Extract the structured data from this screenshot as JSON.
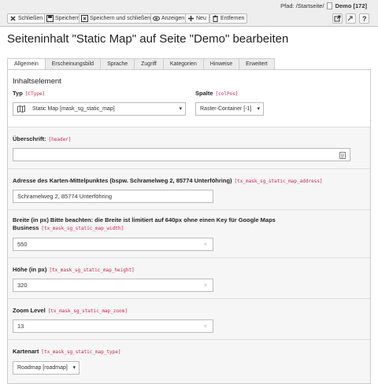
{
  "toolbar": {
    "close": "Schließen",
    "save": "Speichern",
    "save_close": "Speichern und schließen",
    "view": "Anzeigen",
    "new": "Neu",
    "delete": "Entfernen"
  },
  "breadcrumb": {
    "prefix": "Pfad: /Startseite/",
    "page": "Demo [172]"
  },
  "page_title": "Seiteninhalt \"Static Map\" auf Seite \"Demo\" bearbeiten",
  "tabs": [
    "Allgemein",
    "Erscheinungsbild",
    "Sprache",
    "Zugriff",
    "Kategorien",
    "Hinweise",
    "Erweitert"
  ],
  "form": {
    "section_heading": "Inhaltselement",
    "ctype_label": "Typ",
    "ctype_code": "[CType]",
    "ctype_value": "Static Map [mask_sg_static_map]",
    "colpos_label": "Spalte",
    "colpos_code": "[colPos]",
    "colpos_value": "Raster-Container [-1]",
    "header_label": "Überschrift:",
    "header_code": "[header]",
    "header_value": "",
    "address_label": "Adresse des Karten-Mittelpunktes (bspw. Schramelweg 2, 85774 Unterföhring)",
    "address_code": "[tx_mask_sg_static_map_address]",
    "address_value": "Schramelweg 2, 85774 Unterföhring",
    "width_label_1": "Breite (in px) Bitte beachten: die Breite ist limitiert auf 640px ohne einen Key für Google Maps",
    "width_label_2": "Business",
    "width_code": "[tx_mask_sg_static_map_width]",
    "width_value": "550",
    "height_label": "Höhe (in px)",
    "height_code": "[tx_mask_sg_static_map_height]",
    "height_value": "320",
    "zoom_label": "Zoom Level",
    "zoom_code": "[tx_mask_sg_static_map_zoom]",
    "zoom_value": "13",
    "type_label": "Kartenart",
    "type_code": "[tx_mask_sg_static_map_type]",
    "type_value": "Roadmap [roadmap]"
  }
}
